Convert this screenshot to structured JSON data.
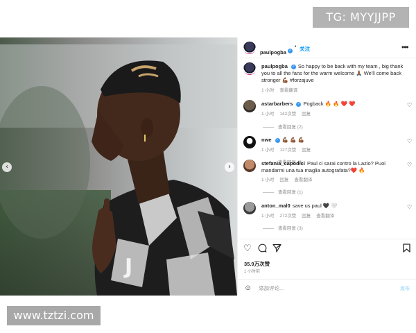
{
  "watermarks": {
    "top": "TG: MYYJJPP",
    "bottom": "www.tztzi.com"
  },
  "post": {
    "header": {
      "username": "paulpogba",
      "verified_icon": "verified-badge-icon",
      "separator": "•",
      "follow": "关注",
      "more": "•••"
    },
    "caption": {
      "username": "paulpogba",
      "text": "So happy to be back with my team , big thank you to all the fans for the warm welcome 🙏🏾 We'll come back stronger 💪🏾 #forzajuve",
      "time": "1 小时",
      "translation": "查看翻译"
    },
    "comments": [
      {
        "username": "astarbarbers",
        "verified": true,
        "text": "Pogback 🔥 🔥 ❤️ ❤️",
        "time": "1 小时",
        "likes": "142次赞",
        "reply": "回复",
        "view_replies": "查看回复 (2)"
      },
      {
        "username": "nwe",
        "verified": true,
        "text": "💪🏾 💪🏾 💪🏾",
        "time": "1 小时",
        "likes": "127次赞",
        "reply": "回复",
        "view_replies": "查看回复 (3)"
      },
      {
        "username": "stefania_capodici",
        "verified": false,
        "text": "Paul ci sarai contro la Lazio? Puoi mandarmi una tua maglia autografata?❤️ 🔥",
        "time": "1 小时",
        "likes": "回复",
        "reply": "查看翻译",
        "view_replies": "查看回复 (1)"
      },
      {
        "username": "anton_mal0",
        "verified": false,
        "text": "save us paul 🖤 🤍",
        "time": "1 小时",
        "likes": "272次赞",
        "reply": "回复",
        "extra": "查看翻译",
        "view_replies": "查看回复 (3)"
      }
    ],
    "actions": {
      "like_icon": "heart-icon",
      "comment_icon": "comment-icon",
      "share_icon": "share-icon",
      "save_icon": "bookmark-icon"
    },
    "likes": "35.9万次赞",
    "time": "1 小时前",
    "add_comment": {
      "emoji_icon": "emoji-icon",
      "placeholder": "添加评论...",
      "post_label": "发布"
    }
  },
  "colors": {
    "link_blue": "#0095f6",
    "verified_blue": "#3897f0",
    "muted_gray": "#8e8e8e"
  }
}
